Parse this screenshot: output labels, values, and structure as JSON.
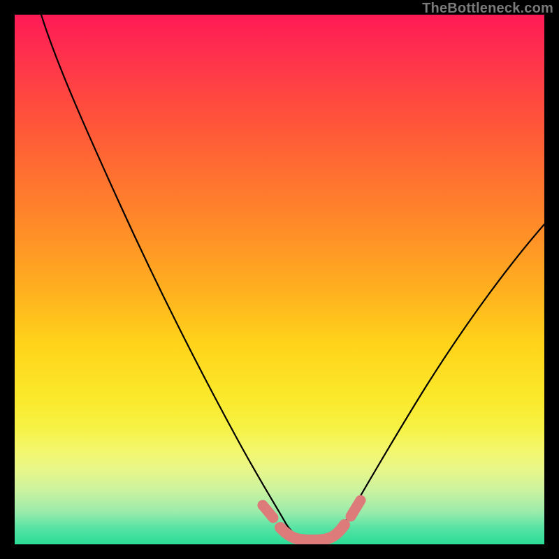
{
  "watermark": "TheBottleneck.com",
  "chart_data": {
    "type": "line",
    "title": "",
    "xlabel": "",
    "ylabel": "",
    "ylim": [
      0,
      100
    ],
    "xlim": [
      0,
      100
    ],
    "series": [
      {
        "name": "curve-left",
        "x": [
          5,
          10,
          15,
          20,
          25,
          30,
          35,
          40,
          45,
          48,
          50,
          52
        ],
        "values": [
          100,
          90,
          78,
          65,
          53,
          41,
          30,
          20,
          11,
          6,
          3,
          1.5
        ]
      },
      {
        "name": "curve-right",
        "x": [
          62,
          65,
          70,
          75,
          80,
          85,
          90,
          95,
          100
        ],
        "values": [
          1.5,
          3,
          8,
          15,
          23,
          32,
          41,
          50,
          60
        ]
      },
      {
        "name": "bottom-flat",
        "x": [
          50,
          52,
          55,
          58,
          60,
          62
        ],
        "values": [
          1.5,
          1,
          0.8,
          0.8,
          1,
          1.5
        ]
      }
    ],
    "highlight": {
      "name": "highlight-segment",
      "color": "#dd7a7a",
      "x": [
        47,
        49,
        51,
        53,
        55,
        57,
        59,
        61,
        63
      ],
      "values": [
        7,
        4,
        2,
        1.2,
        1,
        1.2,
        2,
        4,
        6
      ]
    }
  }
}
